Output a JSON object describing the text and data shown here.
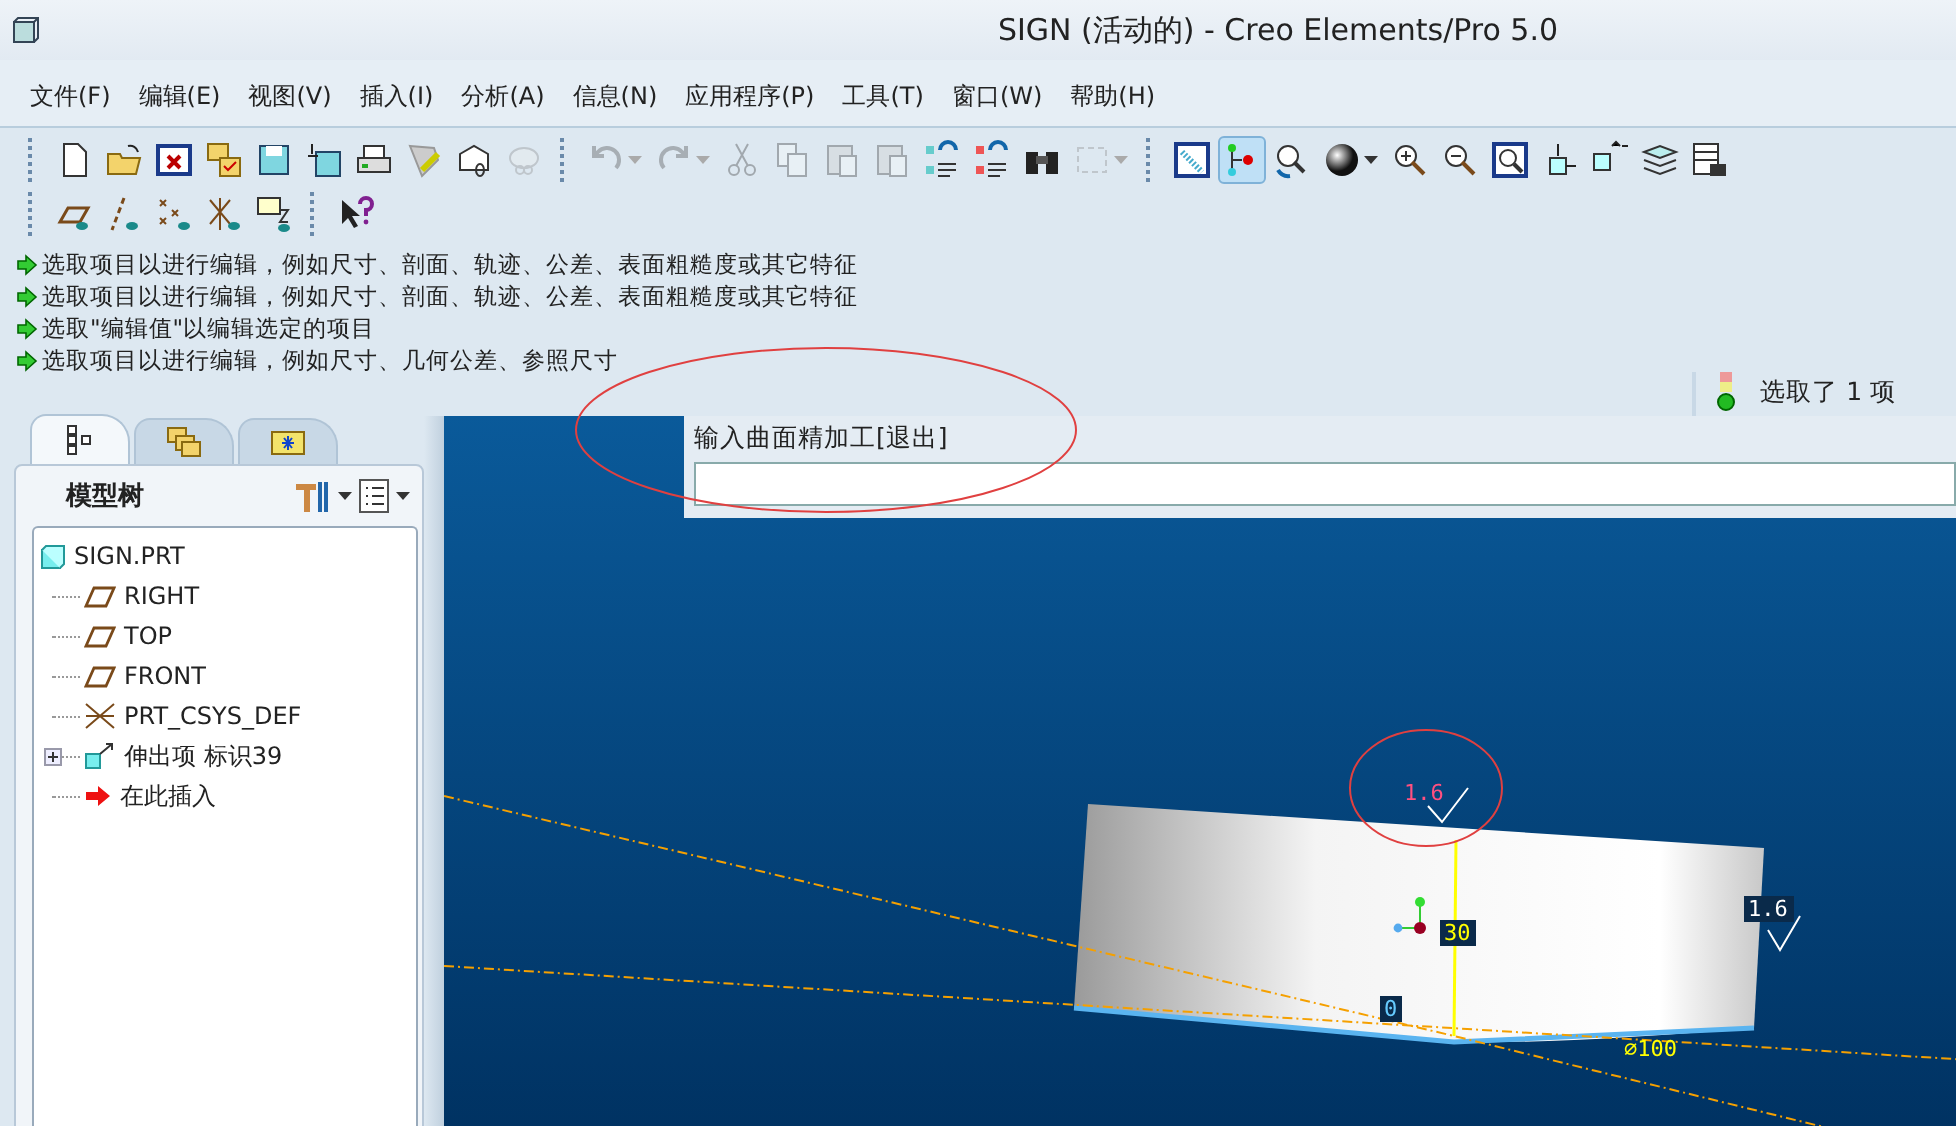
{
  "window": {
    "title": "SIGN (活动的) - Creo Elements/Pro 5.0"
  },
  "menu": [
    "文件(F)",
    "编辑(E)",
    "视图(V)",
    "插入(I)",
    "分析(A)",
    "信息(N)",
    "应用程序(P)",
    "工具(T)",
    "窗口(W)",
    "帮助(H)"
  ],
  "toolbar_rows": [
    [
      [
        {
          "selected": false,
          "disabled": false
        },
        {
          "selected": false,
          "disabled": false
        },
        {
          "selected": false,
          "disabled": false
        },
        {
          "selected": false,
          "disabled": false
        },
        {
          "selected": false,
          "disabled": false
        },
        {
          "selected": false,
          "disabled": false
        },
        {
          "selected": false,
          "disabled": false
        },
        {
          "selected": false,
          "disabled": false
        },
        {
          "selected": false,
          "disabled": false
        },
        {
          "selected": false,
          "disabled": true
        }
      ],
      [
        {
          "selected": false,
          "disabled": true
        },
        {
          "selected": false,
          "disabled": true
        },
        {
          "selected": false,
          "disabled": true
        },
        {
          "selected": false,
          "disabled": true
        },
        {
          "selected": false,
          "disabled": true
        },
        {
          "selected": false,
          "disabled": true
        },
        {
          "selected": false,
          "disabled": false
        },
        {
          "selected": false,
          "disabled": false
        },
        {
          "selected": false,
          "disabled": false
        },
        {
          "selected": false,
          "disabled": true
        }
      ],
      [
        {
          "selected": false,
          "disabled": false
        },
        {
          "selected": true,
          "disabled": false
        },
        {
          "selected": false,
          "disabled": false
        },
        {
          "selected": false,
          "disabled": false
        },
        {
          "selected": false,
          "disabled": false
        },
        {
          "selected": false,
          "disabled": false
        },
        {
          "selected": false,
          "disabled": false
        },
        {
          "selected": false,
          "disabled": false
        },
        {
          "selected": false,
          "disabled": false
        },
        {
          "selected": false,
          "disabled": false
        },
        {
          "selected": false,
          "disabled": false
        }
      ]
    ],
    [
      [
        {
          "selected": false,
          "disabled": false
        },
        {
          "selected": false,
          "disabled": false
        },
        {
          "selected": false,
          "disabled": false
        },
        {
          "selected": false,
          "disabled": false
        },
        {
          "selected": false,
          "disabled": false
        }
      ],
      [
        {
          "selected": false,
          "disabled": false
        }
      ]
    ]
  ],
  "messages": [
    "选取项目以进行编辑，例如尺寸、剖面、轨迹、公差、表面粗糙度或其它特征",
    "选取项目以进行编辑，例如尺寸、剖面、轨迹、公差、表面粗糙度或其它特征",
    "选取\"编辑值\"以编辑选定的项目",
    "选取项目以进行编辑，例如尺寸、几何公差、参照尺寸"
  ],
  "selection_status": "选取了 1 项",
  "model_tree": {
    "tabs": [
      {
        "selected": true
      },
      {
        "selected": false
      },
      {
        "selected": false
      }
    ],
    "title": "模型树",
    "items": [
      {
        "label": "SIGN.PRT",
        "kind": "part",
        "children": [
          {
            "label": "RIGHT",
            "kind": "plane"
          },
          {
            "label": "TOP",
            "kind": "plane"
          },
          {
            "label": "FRONT",
            "kind": "plane"
          },
          {
            "label": "PRT_CSYS_DEF",
            "kind": "csys"
          },
          {
            "label": "伸出项 标识39",
            "kind": "feature",
            "expanded": false
          },
          {
            "label": "在此插入",
            "kind": "insert"
          }
        ]
      }
    ]
  },
  "input_dialog": {
    "prompt": "输入曲面精加工[退出]"
  },
  "viewport": {
    "labels": [
      {
        "text": "1.6",
        "kind": "roughness"
      },
      {
        "text": "1.6",
        "kind": "roughness_boxed"
      },
      {
        "text": "30",
        "kind": "dimension_boxed"
      },
      {
        "text": "0",
        "kind": "dimension_boxed"
      },
      {
        "text": "⌀100",
        "kind": "dimension"
      }
    ]
  }
}
